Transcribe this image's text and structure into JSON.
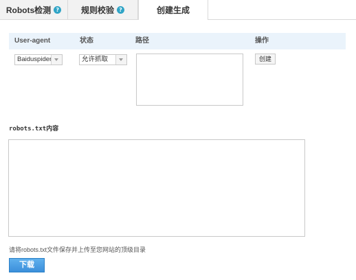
{
  "tabs": [
    {
      "label": "Robots检测",
      "help": "?"
    },
    {
      "label": "规则校验",
      "help": "?"
    },
    {
      "label": "创建生成"
    }
  ],
  "table": {
    "headers": [
      "User-agent",
      "状态",
      "路径",
      "操作"
    ],
    "row": {
      "user_agent": "Baiduspider",
      "status": "允许抓取",
      "path": "",
      "action": "创建"
    }
  },
  "content": {
    "label_mono": "robots.txt",
    "label_suffix": "内容",
    "value": ""
  },
  "hint": "请将robots.txt文件保存并上传至您网站的顶级目录",
  "download_label": "下载",
  "colors": {
    "accent": "#3b8fdb",
    "help_icon": "#2fa4c6",
    "table_header_bg": "#eaf3fb"
  }
}
